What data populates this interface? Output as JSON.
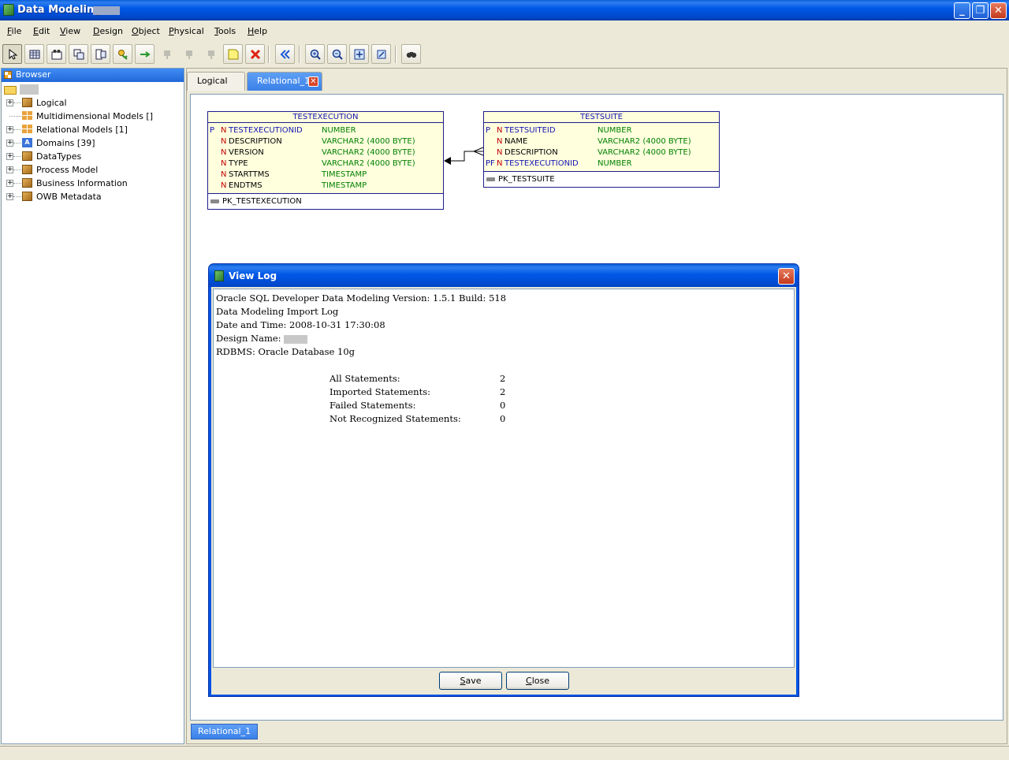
{
  "window": {
    "title": "Data Modeling -"
  },
  "menu": [
    "File",
    "Edit",
    "View",
    "Design",
    "Object",
    "Physical",
    "Tools",
    "Help"
  ],
  "toolbar": {
    "buttons": [
      "select-icon",
      "new-table-icon",
      "new-view-icon",
      "split-table-icon",
      "merge-tables-icon",
      "new-fk-icon",
      "arrow-right-icon",
      "fk-1-1-icon",
      "fk-1-n-icon",
      "fk-n-n-icon",
      "new-note-icon",
      "delete-icon",
      "engineer-to-logical-icon",
      "zoom-in-icon",
      "zoom-out-icon",
      "fit-screen-icon",
      "default-size-icon",
      "find-icon"
    ]
  },
  "browser": {
    "title": "Browser",
    "items": [
      {
        "label": "Logical",
        "icon": "cube-icon",
        "expandable": true
      },
      {
        "label": "Multidimensional Models []",
        "icon": "grid-icon",
        "expandable": false
      },
      {
        "label": "Relational Models [1]",
        "icon": "grid-icon",
        "expandable": true
      },
      {
        "label": "Domains [39]",
        "icon": "domain-icon",
        "expandable": true
      },
      {
        "label": "DataTypes",
        "icon": "cube-icon",
        "expandable": true
      },
      {
        "label": "Process Model",
        "icon": "cube-icon",
        "expandable": true
      },
      {
        "label": "Business Information",
        "icon": "cube-icon",
        "expandable": true
      },
      {
        "label": "OWB Metadata",
        "icon": "cube-icon",
        "expandable": true
      }
    ]
  },
  "tabs": {
    "logical": "Logical",
    "relational": "Relational_1",
    "bottom": "Relational_1"
  },
  "tables": [
    {
      "name": "TESTEXECUTION",
      "columns": [
        {
          "key": "P",
          "nn": "N",
          "name": "TESTEXECUTIONID",
          "type": "NUMBER",
          "pk": true
        },
        {
          "key": "",
          "nn": "N",
          "name": "DESCRIPTION",
          "type": "VARCHAR2 (4000 BYTE)",
          "pk": false
        },
        {
          "key": "",
          "nn": "N",
          "name": "VERSION",
          "type": "VARCHAR2 (4000 BYTE)",
          "pk": false
        },
        {
          "key": "",
          "nn": "N",
          "name": "TYPE",
          "type": "VARCHAR2 (4000 BYTE)",
          "pk": false
        },
        {
          "key": "",
          "nn": "N",
          "name": "STARTTMS",
          "type": "TIMESTAMP",
          "pk": false
        },
        {
          "key": "",
          "nn": "N",
          "name": "ENDTMS",
          "type": "TIMESTAMP",
          "pk": false
        }
      ],
      "constraint": "PK_TESTEXECUTION"
    },
    {
      "name": "TESTSUITE",
      "columns": [
        {
          "key": "P",
          "nn": "N",
          "name": "TESTSUITEID",
          "type": "NUMBER",
          "pk": true
        },
        {
          "key": "",
          "nn": "N",
          "name": "NAME",
          "type": "VARCHAR2 (4000 BYTE)",
          "pk": false
        },
        {
          "key": "",
          "nn": "N",
          "name": "DESCRIPTION",
          "type": "VARCHAR2 (4000 BYTE)",
          "pk": false
        },
        {
          "key": "PF",
          "nn": "N",
          "name": "TESTEXECUTIONID",
          "type": "NUMBER",
          "pk": true
        }
      ],
      "constraint": "PK_TESTSUITE"
    }
  ],
  "dialog": {
    "title": "View Log",
    "lines": [
      "Oracle SQL Developer Data Modeling Version: 1.5.1 Build: 518",
      "Data Modeling Import Log",
      "Date and Time: 2008-10-31 17:30:08",
      "Design Name:",
      "RDBMS: Oracle Database 10g"
    ],
    "stats": [
      {
        "label": "All Statements:",
        "value": "2"
      },
      {
        "label": "Imported Statements:",
        "value": "2"
      },
      {
        "label": "Failed Statements:",
        "value": "0"
      },
      {
        "label": "Not Recognized Statements:",
        "value": "0"
      }
    ],
    "save_label": "Save",
    "close_label": "Close"
  }
}
